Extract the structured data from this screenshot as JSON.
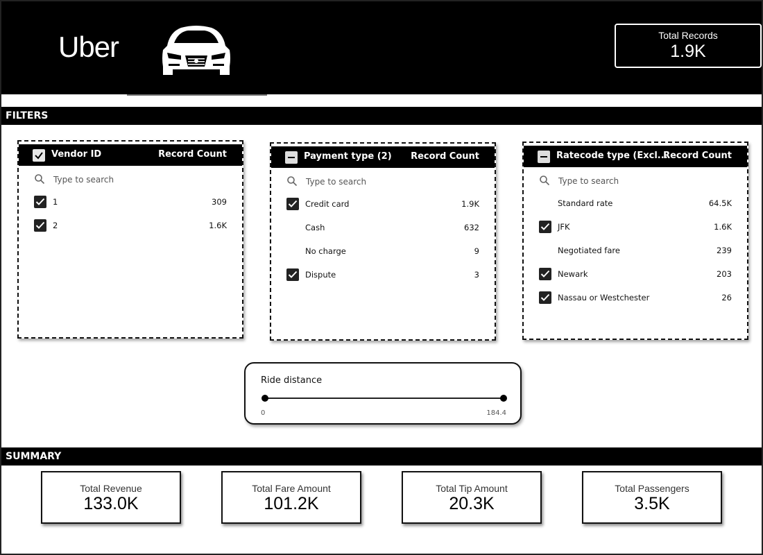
{
  "header": {
    "logo_text": "Uber",
    "total_records": {
      "label": "Total Records",
      "value": "1.9K"
    }
  },
  "sections": {
    "filters": "FILTERS",
    "summary": "SUMMARY"
  },
  "filters": {
    "vendor": {
      "title": "Vendor ID",
      "count_header": "Record Count",
      "search_placeholder": "Type to search",
      "items": [
        {
          "name": "1",
          "count": "309",
          "checked": true
        },
        {
          "name": "2",
          "count": "1.6K",
          "checked": true
        }
      ]
    },
    "payment": {
      "title": "Payment type (2)",
      "count_header": "Record Count",
      "search_placeholder": "Type to search",
      "items": [
        {
          "name": "Credit card",
          "count": "1.9K",
          "checked": true
        },
        {
          "name": "Cash",
          "count": "632",
          "checked": false
        },
        {
          "name": "No charge",
          "count": "9",
          "checked": false
        },
        {
          "name": "Dispute",
          "count": "3",
          "checked": true
        }
      ]
    },
    "ratecode": {
      "title": "Ratecode type (Excl...",
      "count_header": "Record Count",
      "search_placeholder": "Type to search",
      "items": [
        {
          "name": "Standard rate",
          "count": "64.5K",
          "checked": false
        },
        {
          "name": "JFK",
          "count": "1.6K",
          "checked": true
        },
        {
          "name": "Negotiated fare",
          "count": "239",
          "checked": false
        },
        {
          "name": "Newark",
          "count": "203",
          "checked": true
        },
        {
          "name": "Nassau or Westchester",
          "count": "26",
          "checked": true
        }
      ]
    }
  },
  "ride_distance": {
    "label": "Ride distance",
    "min": "0",
    "max": "184.4"
  },
  "summary": {
    "revenue": {
      "label": "Total Revenue",
      "value": "133.0K"
    },
    "fare": {
      "label": "Total Fare Amount",
      "value": "101.2K"
    },
    "tip": {
      "label": "Total Tip Amount",
      "value": "20.3K"
    },
    "passengers": {
      "label": "Total Passengers",
      "value": "3.5K"
    }
  }
}
